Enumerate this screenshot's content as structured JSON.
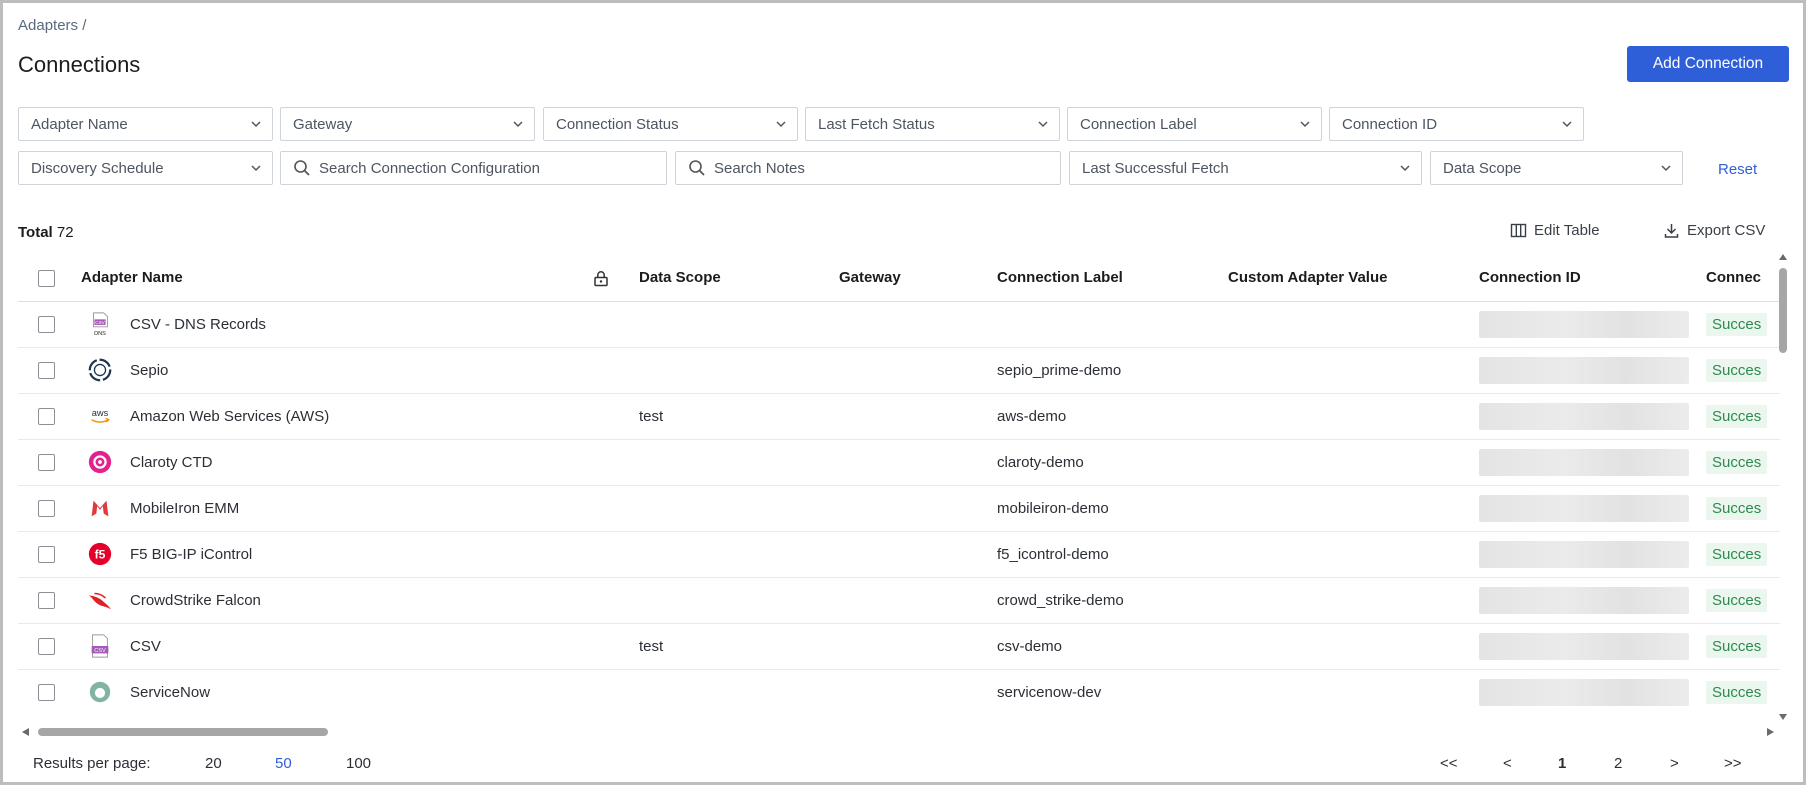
{
  "breadcrumb": "Adapters /",
  "page_title": "Connections",
  "add_button": "Add Connection",
  "filters": {
    "adapter_name": "Adapter Name",
    "gateway": "Gateway",
    "connection_status": "Connection Status",
    "last_fetch_status": "Last Fetch Status",
    "connection_label": "Connection Label",
    "connection_id": "Connection ID",
    "discovery_schedule": "Discovery Schedule",
    "search_config": "Search Connection Configuration",
    "search_notes": "Search Notes",
    "last_successful_fetch": "Last Successful Fetch",
    "data_scope": "Data Scope",
    "reset": "Reset"
  },
  "summary": {
    "total_label": "Total",
    "total_value": "72"
  },
  "toolbar": {
    "edit_table": "Edit Table",
    "export_csv": "Export CSV"
  },
  "columns": {
    "adapter_name": "Adapter Name",
    "data_scope": "Data Scope",
    "gateway": "Gateway",
    "connection_label": "Connection Label",
    "custom_adapter_value": "Custom Adapter Value",
    "connection_id": "Connection ID",
    "connection_status": "Connec"
  },
  "rows": [
    {
      "adapter": "CSV - DNS Records",
      "logo": "csv-dns-icon",
      "data_scope": "",
      "gateway": "",
      "label": "",
      "custom": "",
      "status": "Succes"
    },
    {
      "adapter": "Sepio",
      "logo": "sepio-icon",
      "data_scope": "",
      "gateway": "",
      "label": "sepio_prime-demo",
      "custom": "",
      "status": "Succes"
    },
    {
      "adapter": "Amazon Web Services (AWS)",
      "logo": "aws-icon",
      "data_scope": "test",
      "gateway": "",
      "label": "aws-demo",
      "custom": "",
      "status": "Succes"
    },
    {
      "adapter": "Claroty CTD",
      "logo": "claroty-icon",
      "data_scope": "",
      "gateway": "",
      "label": "claroty-demo",
      "custom": "",
      "status": "Succes"
    },
    {
      "adapter": "MobileIron EMM",
      "logo": "mobileiron-icon",
      "data_scope": "",
      "gateway": "",
      "label": "mobileiron-demo",
      "custom": "",
      "status": "Succes"
    },
    {
      "adapter": "F5 BIG-IP iControl",
      "logo": "f5-icon",
      "data_scope": "",
      "gateway": "",
      "label": "f5_icontrol-demo",
      "custom": "",
      "status": "Succes"
    },
    {
      "adapter": "CrowdStrike Falcon",
      "logo": "crowdstrike-icon",
      "data_scope": "",
      "gateway": "",
      "label": "crowd_strike-demo",
      "custom": "",
      "status": "Succes"
    },
    {
      "adapter": "CSV",
      "logo": "csv-icon",
      "data_scope": "test",
      "gateway": "",
      "label": "csv-demo",
      "custom": "",
      "status": "Succes"
    },
    {
      "adapter": "ServiceNow",
      "logo": "servicenow-icon",
      "data_scope": "",
      "gateway": "",
      "label": "servicenow-dev",
      "custom": "",
      "status": "Succes"
    }
  ],
  "footer": {
    "results_per_page": "Results per page:",
    "options": [
      "20",
      "50",
      "100"
    ],
    "selected_option": "50",
    "pagination": {
      "first": "<<",
      "prev": "<",
      "page1": "1",
      "page2": "2",
      "next": ">",
      "last": ">>",
      "current": "1"
    }
  },
  "colors": {
    "accent": "#2f5fd8",
    "success_bg": "#eaf6ee",
    "success_text": "#2e8a4f"
  }
}
